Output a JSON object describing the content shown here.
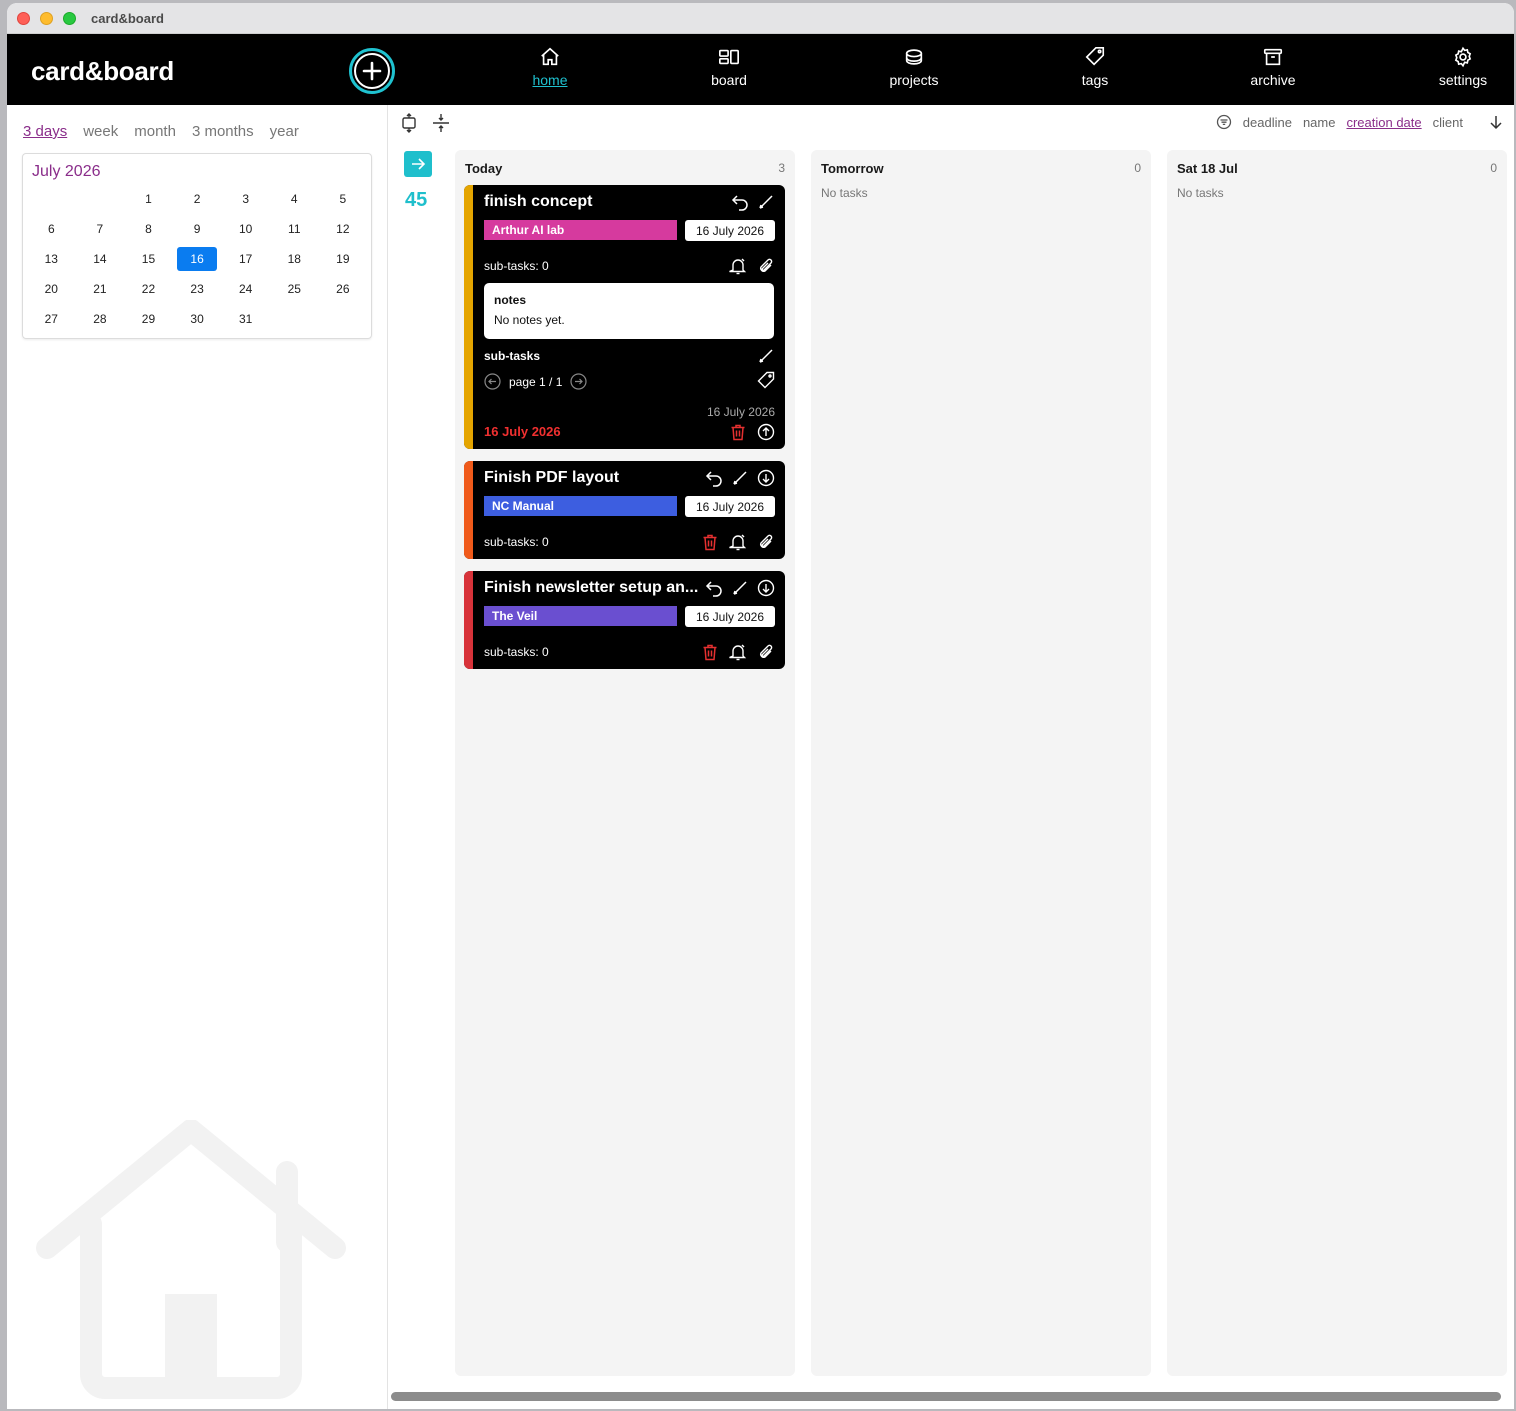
{
  "window": {
    "title": "card&board"
  },
  "brand": "card&board",
  "nav": [
    {
      "label": "home",
      "icon": "home-icon",
      "active": true
    },
    {
      "label": "board",
      "icon": "board-icon"
    },
    {
      "label": "projects",
      "icon": "projects-icon"
    },
    {
      "label": "tags",
      "icon": "tag-icon"
    },
    {
      "label": "archive",
      "icon": "archive-icon"
    },
    {
      "label": "settings",
      "icon": "gear-icon"
    }
  ],
  "range_tabs": [
    "3 days",
    "week",
    "month",
    "3 months",
    "year"
  ],
  "range_active": "3 days",
  "calendar": {
    "title": "July 2026",
    "selected": "16",
    "weeks": [
      [
        "",
        "",
        "1",
        "2",
        "3",
        "4",
        "5"
      ],
      [
        "6",
        "7",
        "8",
        "9",
        "10",
        "11",
        "12"
      ],
      [
        "13",
        "14",
        "15",
        "16",
        "17",
        "18",
        "19"
      ],
      [
        "20",
        "21",
        "22",
        "23",
        "24",
        "25",
        "26"
      ],
      [
        "27",
        "28",
        "29",
        "30",
        "31",
        "",
        ""
      ]
    ]
  },
  "sort": {
    "options": [
      "deadline",
      "name",
      "creation date",
      "client"
    ],
    "active": "creation date"
  },
  "counter": "45",
  "columns": [
    {
      "title": "Today",
      "count": "3",
      "empty_text": ""
    },
    {
      "title": "Tomorrow",
      "count": "0",
      "empty_text": "No tasks"
    },
    {
      "title": "Sat 18 Jul",
      "count": "0",
      "empty_text": "No tasks"
    }
  ],
  "cards": [
    {
      "title": "finish concept",
      "stripe": "#e5a500",
      "tag": "Arthur AI lab",
      "tag_color": "#d63a9e",
      "date": "16 July 2026",
      "subtasks": "sub-tasks: 0",
      "notes_title": "notes",
      "notes_text": "No notes yet.",
      "subtasks_heading": "sub-tasks",
      "pager": "page 1 / 1",
      "created": "16 July 2026",
      "deadline": "16 July 2026"
    },
    {
      "title": "Finish PDF layout",
      "stripe": "#f05a1a",
      "tag": "NC Manual",
      "tag_color": "#3d5ee0",
      "date": "16 July 2026",
      "subtasks": "sub-tasks: 0"
    },
    {
      "title": "Finish newsletter setup an...",
      "stripe": "#d8333a",
      "tag": "The Veil",
      "tag_color": "#6a4fd0",
      "date": "16 July 2026",
      "subtasks": "sub-tasks: 0"
    }
  ]
}
